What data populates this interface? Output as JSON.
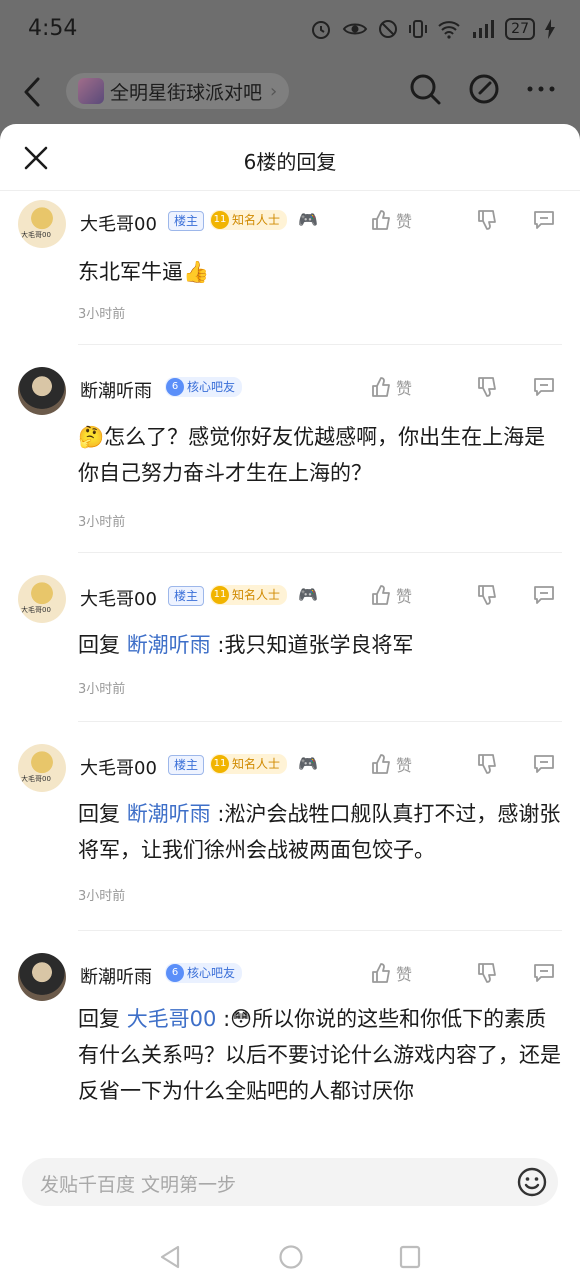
{
  "status_bar": {
    "time": "4:54",
    "battery": "27"
  },
  "topnav": {
    "forum_name": "全明星街球派对吧"
  },
  "sheet": {
    "title": "6楼的回复"
  },
  "replies": [
    {
      "username": "大毛哥00",
      "badge_louzhu": "楼主",
      "badge_famous_level": "11",
      "badge_famous": "知名人士",
      "like_label": "赞",
      "content": "东北军牛逼👍",
      "time": "3小时前"
    },
    {
      "username": "断潮听雨",
      "badge_core_level": "6",
      "badge_core": "核心吧友",
      "like_label": "赞",
      "content": "🤔怎么了？感觉你好友优越感啊，你出生在上海是你自己努力奋斗才生在上海的？",
      "time": "3小时前"
    },
    {
      "username": "大毛哥00",
      "badge_louzhu": "楼主",
      "badge_famous_level": "11",
      "badge_famous": "知名人士",
      "like_label": "赞",
      "reply_prefix": "回复",
      "mention": "断潮听雨",
      "content": " :我只知道张学良将军",
      "time": "3小时前"
    },
    {
      "username": "大毛哥00",
      "badge_louzhu": "楼主",
      "badge_famous_level": "11",
      "badge_famous": "知名人士",
      "like_label": "赞",
      "reply_prefix": "回复",
      "mention": "断潮听雨",
      "content": " :淞沪会战牲口舰队真打不过，感谢张将军，让我们徐州会战被两面包饺子。",
      "time": "3小时前"
    },
    {
      "username": "断潮听雨",
      "badge_core_level": "6",
      "badge_core": "核心吧友",
      "like_label": "赞",
      "reply_prefix": "回复",
      "mention": "大毛哥00",
      "content": " :😳所以你说的这些和你低下的素质有什么关系吗？以后不要讨论什么游戏内容了，还是反省一下为什么全贴吧的人都讨厌你"
    }
  ],
  "input": {
    "placeholder": "发贴千百度 文明第一步"
  },
  "colors": {
    "mention": "#3e6fc8",
    "famous_badge": "#f1b400",
    "core_badge": "#5b8ff9"
  }
}
